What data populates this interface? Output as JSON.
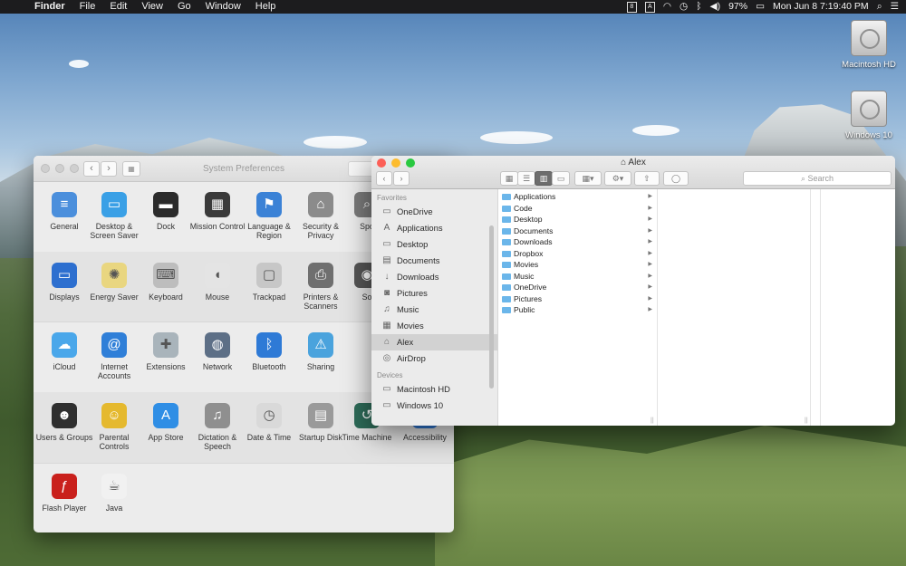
{
  "menubar": {
    "apple": "",
    "app": "Finder",
    "menus": [
      "File",
      "Edit",
      "View",
      "Go",
      "Window",
      "Help"
    ],
    "status": {
      "indicator_8": "8",
      "indicator_a": "A",
      "battery": "97%",
      "datetime": "Mon Jun 8  7:19:40 PM"
    }
  },
  "desktop": {
    "disks": [
      "Macintosh HD",
      "Windows 10"
    ]
  },
  "system_preferences": {
    "title": "System Preferences",
    "rows": [
      [
        {
          "label": "General",
          "icon": "general-icon",
          "color": "#4b8fdc"
        },
        {
          "label": "Desktop & Screen Saver",
          "icon": "desktop-icon",
          "color": "#3aa0e6"
        },
        {
          "label": "Dock",
          "icon": "dock-icon",
          "color": "#2b2b2b"
        },
        {
          "label": "Mission Control",
          "icon": "mission-control-icon",
          "color": "#3a3a3a"
        },
        {
          "label": "Language & Region",
          "icon": "globe-flag-icon",
          "color": "#3b82d6"
        },
        {
          "label": "Security & Privacy",
          "icon": "house-lock-icon",
          "color": "#8b8b8b"
        },
        {
          "label": "Spo",
          "icon": "spotlight-icon",
          "color": "#7a7a7a"
        }
      ],
      [
        {
          "label": "Displays",
          "icon": "display-icon",
          "color": "#2d6fcf"
        },
        {
          "label": "Energy Saver",
          "icon": "bulb-icon",
          "color": "#e9d680"
        },
        {
          "label": "Keyboard",
          "icon": "keyboard-icon",
          "color": "#bdbdbd"
        },
        {
          "label": "Mouse",
          "icon": "mouse-icon",
          "color": "#e4e4e4"
        },
        {
          "label": "Trackpad",
          "icon": "trackpad-icon",
          "color": "#c7c7c7"
        },
        {
          "label": "Printers & Scanners",
          "icon": "printer-icon",
          "color": "#6f6f6f"
        },
        {
          "label": "So",
          "icon": "speaker-icon",
          "color": "#555"
        }
      ],
      [
        {
          "label": "iCloud",
          "icon": "cloud-icon",
          "color": "#4aa7ea"
        },
        {
          "label": "Internet Accounts",
          "icon": "at-icon",
          "color": "#2f7fd8"
        },
        {
          "label": "Extensions",
          "icon": "puzzle-icon",
          "color": "#a9b4bb"
        },
        {
          "label": "Network",
          "icon": "network-globe-icon",
          "color": "#5d6f86"
        },
        {
          "label": "Bluetooth",
          "icon": "bluetooth-icon",
          "color": "#2e7ad6"
        },
        {
          "label": "Sharing",
          "icon": "sharing-folder-icon",
          "color": "#4aa3dd"
        }
      ],
      [
        {
          "label": "Users & Groups",
          "icon": "users-icon",
          "color": "#2f2f2f"
        },
        {
          "label": "Parental Controls",
          "icon": "parental-icon",
          "color": "#e5b92e"
        },
        {
          "label": "App Store",
          "icon": "app-store-icon",
          "color": "#2f8ee5"
        },
        {
          "label": "Dictation & Speech",
          "icon": "microphone-icon",
          "color": "#8f8f8f"
        },
        {
          "label": "Date & Time",
          "icon": "clock-icon",
          "color": "#d9d9d9"
        },
        {
          "label": "Startup Disk",
          "icon": "disk-icon",
          "color": "#9a9a9a"
        },
        {
          "label": "Time Machine",
          "icon": "time-machine-icon",
          "color": "#2d6b58"
        },
        {
          "label": "Accessibility",
          "icon": "accessibility-icon",
          "color": "#2f77d2"
        }
      ],
      [
        {
          "label": "Flash Player",
          "icon": "flash-icon",
          "color": "#c9201c"
        },
        {
          "label": "Java",
          "icon": "java-icon",
          "color": "#f1f1f1"
        }
      ]
    ],
    "icon_glyphs": {
      "general-icon": "≡",
      "desktop-icon": "▭",
      "dock-icon": "▬",
      "mission-control-icon": "▦",
      "globe-flag-icon": "⚑",
      "house-lock-icon": "⌂",
      "spotlight-icon": "⌕",
      "display-icon": "▭",
      "bulb-icon": "✺",
      "keyboard-icon": "⌨",
      "mouse-icon": "◖",
      "trackpad-icon": "▢",
      "printer-icon": "⎙",
      "speaker-icon": "◉",
      "cloud-icon": "☁",
      "at-icon": "@",
      "puzzle-icon": "✚",
      "network-globe-icon": "◍",
      "bluetooth-icon": "ᛒ",
      "sharing-folder-icon": "⚠",
      "users-icon": "☻",
      "parental-icon": "☺",
      "app-store-icon": "A",
      "microphone-icon": "♫",
      "clock-icon": "◷",
      "disk-icon": "▤",
      "time-machine-icon": "↺",
      "accessibility-icon": "♿",
      "flash-icon": "ƒ",
      "java-icon": "☕"
    }
  },
  "finder": {
    "title": "Alex",
    "search_placeholder": "Search",
    "sidebar": {
      "favorites_header": "Favorites",
      "favorites": [
        {
          "label": "OneDrive",
          "icon": "folder-icon",
          "glyph": "▭"
        },
        {
          "label": "Applications",
          "icon": "applications-icon",
          "glyph": "A"
        },
        {
          "label": "Desktop",
          "icon": "desktop-icon",
          "glyph": "▭"
        },
        {
          "label": "Documents",
          "icon": "documents-icon",
          "glyph": "▤"
        },
        {
          "label": "Downloads",
          "icon": "downloads-icon",
          "glyph": "↓"
        },
        {
          "label": "Pictures",
          "icon": "pictures-icon",
          "glyph": "◙"
        },
        {
          "label": "Music",
          "icon": "music-icon",
          "glyph": "♫"
        },
        {
          "label": "Movies",
          "icon": "movies-icon",
          "glyph": "▦"
        },
        {
          "label": "Alex",
          "icon": "home-icon",
          "glyph": "⌂",
          "selected": true
        },
        {
          "label": "AirDrop",
          "icon": "airdrop-icon",
          "glyph": "◎"
        }
      ],
      "devices_header": "Devices",
      "devices": [
        {
          "label": "Macintosh HD",
          "icon": "hard-drive-icon",
          "glyph": "▭"
        },
        {
          "label": "Windows 10",
          "icon": "hard-drive-icon",
          "glyph": "▭"
        }
      ]
    },
    "column1": [
      "Applications",
      "Code",
      "Desktop",
      "Documents",
      "Downloads",
      "Dropbox",
      "Movies",
      "Music",
      "OneDrive",
      "Pictures",
      "Public"
    ]
  }
}
